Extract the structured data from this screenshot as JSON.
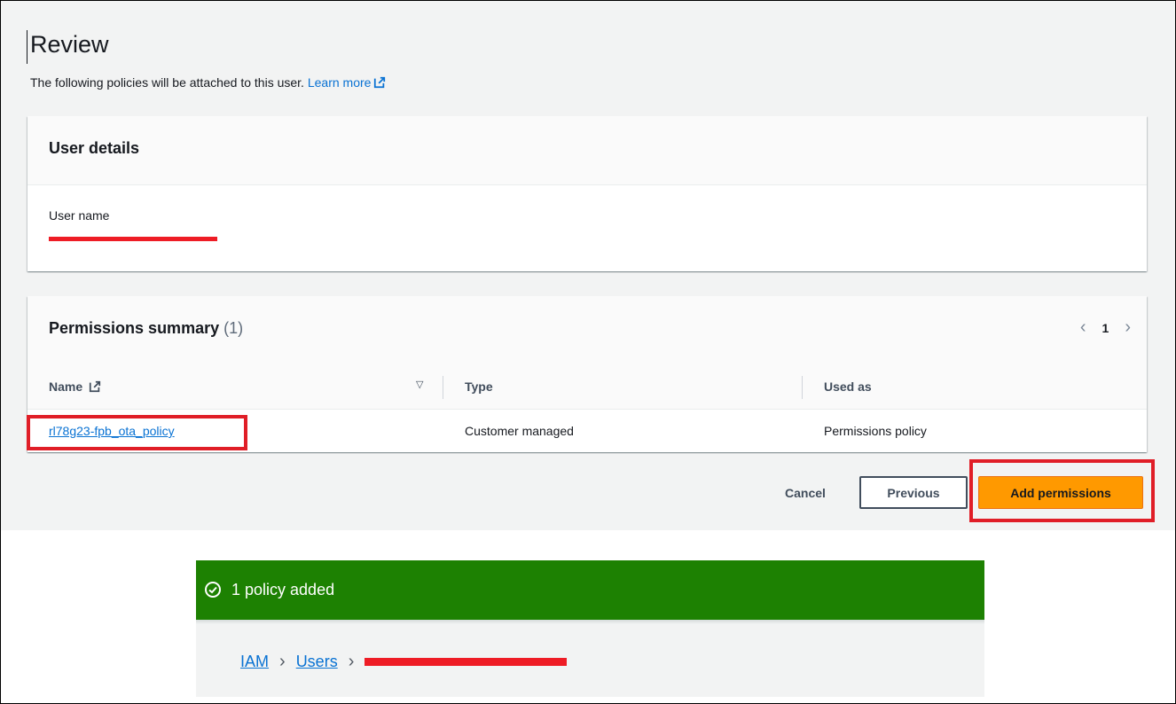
{
  "review": {
    "title": "Review",
    "subtitle": "The following policies will be attached to this user.",
    "learn_more": "Learn more"
  },
  "user_details": {
    "heading": "User details",
    "user_name_label": "User name"
  },
  "permissions": {
    "heading": "Permissions summary",
    "count": "(1)",
    "page": "1",
    "columns": {
      "name": "Name",
      "type": "Type",
      "used_as": "Used as"
    },
    "rows": [
      {
        "name": "rl78g23-fpb_ota_policy",
        "type": "Customer managed",
        "used_as": "Permissions policy"
      }
    ]
  },
  "actions": {
    "cancel": "Cancel",
    "previous": "Previous",
    "add": "Add permissions"
  },
  "flash": {
    "message": "1 policy added"
  },
  "breadcrumb": {
    "iam": "IAM",
    "users": "Users"
  },
  "colors": {
    "link": "#0972d3",
    "primary": "#ff9900",
    "success": "#1d8102",
    "redaction": "#ee1c25",
    "highlight": "#e01e27"
  },
  "icons": {
    "external": "external-link-icon",
    "success": "check-circle-icon",
    "sort": "sort-down-icon",
    "chevron": "chevron-right-icon"
  }
}
